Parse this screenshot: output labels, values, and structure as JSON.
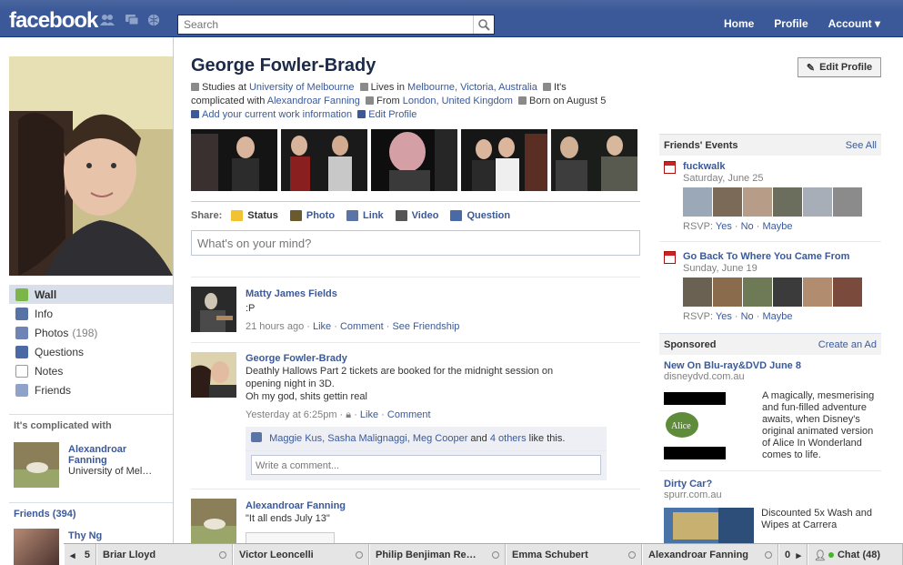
{
  "topbar": {
    "logo": "facebook",
    "search_placeholder": "Search",
    "nav": [
      "Home",
      "Profile",
      "Account ▾"
    ]
  },
  "profile": {
    "name": "George Fowler-Brady",
    "edit_profile": "Edit Profile",
    "info": {
      "studies_prefix": "Studies at",
      "school": "University of Melbourne",
      "lives_prefix": "Lives in",
      "city": "Melbourne, Victoria, Australia",
      "relationship_prefix": "It's complicated with",
      "partner": "Alexandroar Fanning",
      "from_prefix": "From",
      "hometown": "London, United Kingdom",
      "born_prefix": "Born on",
      "birthday": "August 5",
      "add_work": "Add your current work information",
      "edit_profile_link": "Edit Profile"
    }
  },
  "sidebar": {
    "items": [
      {
        "label": "Wall",
        "count": ""
      },
      {
        "label": "Info",
        "count": ""
      },
      {
        "label": "Photos",
        "count": "(198)"
      },
      {
        "label": "Questions",
        "count": ""
      },
      {
        "label": "Notes",
        "count": ""
      },
      {
        "label": "Friends",
        "count": ""
      }
    ],
    "relationship_head": "It's complicated with",
    "relationship_name1": "Alexandroar",
    "relationship_name2": "Fanning",
    "relationship_school": "University of Mel…",
    "friends_head": "Friends",
    "friends_count": "(394)",
    "first_friend": "Thy Ng"
  },
  "share": {
    "label": "Share:",
    "options": [
      "Status",
      "Photo",
      "Link",
      "Video",
      "Question"
    ],
    "composer_placeholder": "What's on your mind?"
  },
  "stories": [
    {
      "actor": "Matty James Fields",
      "message": ":P",
      "time": "21 hours ago",
      "actions": [
        "Like",
        "Comment",
        "See Friendship"
      ]
    },
    {
      "actor": "George Fowler-Brady",
      "message_line1": "Deathly Hallows Part 2 tickets are booked for the midnight session on",
      "message_line2": "opening night in 3D.",
      "message_line3": "Oh my god, shits gettin real",
      "time": "Yesterday at 6:25pm",
      "actions": [
        "Like",
        "Comment"
      ],
      "likers": "Maggie Kus, Sasha Malignaggi, Meg Cooper",
      "likers_and": "and",
      "likers_others": "4 others",
      "likers_suffix": "like this.",
      "comment_placeholder": "Write a comment..."
    },
    {
      "actor": "Alexandroar Fanning",
      "message": "\"It all ends July 13\""
    }
  ],
  "events": {
    "head": "Friends' Events",
    "see_all": "See All",
    "list": [
      {
        "title": "fuckwalk",
        "date": "Saturday, June 25"
      },
      {
        "title": "Go Back To Where You Came From",
        "date": "Sunday, June 19"
      }
    ],
    "rsvp_label": "RSVP:",
    "rsvp_yes": "Yes",
    "rsvp_no": "No",
    "rsvp_maybe": "Maybe"
  },
  "sponsored": {
    "head": "Sponsored",
    "create_ad": "Create an Ad",
    "ads": [
      {
        "title": "New On Blu-ray&DVD June 8",
        "domain": "disneydvd.com.au",
        "text": "A magically, mesmerising and fun-filled adventure awaits, when Disney's original animated version of Alice In Wonderland comes to life."
      },
      {
        "title": "Dirty Car?",
        "domain": "spurr.com.au",
        "text": "Discounted 5x Wash and Wipes at Carrera"
      }
    ]
  },
  "chatbar": {
    "prev_count": "5",
    "tabs": [
      "Briar Lloyd",
      "Victor Leoncelli",
      "Philip Benjiman Re…",
      "Emma Schubert",
      "Alexandroar Fanning"
    ],
    "next_count": "0",
    "chat_label": "Chat (48)"
  }
}
